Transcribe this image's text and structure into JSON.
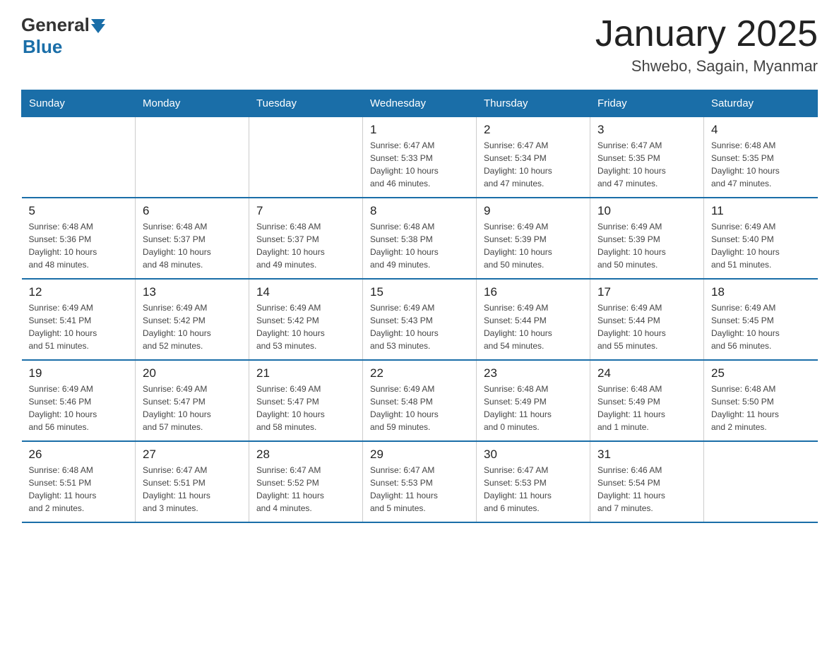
{
  "header": {
    "logo_general": "General",
    "logo_blue": "Blue",
    "month_year": "January 2025",
    "location": "Shwebo, Sagain, Myanmar"
  },
  "weekdays": [
    "Sunday",
    "Monday",
    "Tuesday",
    "Wednesday",
    "Thursday",
    "Friday",
    "Saturday"
  ],
  "weeks": [
    [
      {
        "day": "",
        "info": ""
      },
      {
        "day": "",
        "info": ""
      },
      {
        "day": "",
        "info": ""
      },
      {
        "day": "1",
        "info": "Sunrise: 6:47 AM\nSunset: 5:33 PM\nDaylight: 10 hours\nand 46 minutes."
      },
      {
        "day": "2",
        "info": "Sunrise: 6:47 AM\nSunset: 5:34 PM\nDaylight: 10 hours\nand 47 minutes."
      },
      {
        "day": "3",
        "info": "Sunrise: 6:47 AM\nSunset: 5:35 PM\nDaylight: 10 hours\nand 47 minutes."
      },
      {
        "day": "4",
        "info": "Sunrise: 6:48 AM\nSunset: 5:35 PM\nDaylight: 10 hours\nand 47 minutes."
      }
    ],
    [
      {
        "day": "5",
        "info": "Sunrise: 6:48 AM\nSunset: 5:36 PM\nDaylight: 10 hours\nand 48 minutes."
      },
      {
        "day": "6",
        "info": "Sunrise: 6:48 AM\nSunset: 5:37 PM\nDaylight: 10 hours\nand 48 minutes."
      },
      {
        "day": "7",
        "info": "Sunrise: 6:48 AM\nSunset: 5:37 PM\nDaylight: 10 hours\nand 49 minutes."
      },
      {
        "day": "8",
        "info": "Sunrise: 6:48 AM\nSunset: 5:38 PM\nDaylight: 10 hours\nand 49 minutes."
      },
      {
        "day": "9",
        "info": "Sunrise: 6:49 AM\nSunset: 5:39 PM\nDaylight: 10 hours\nand 50 minutes."
      },
      {
        "day": "10",
        "info": "Sunrise: 6:49 AM\nSunset: 5:39 PM\nDaylight: 10 hours\nand 50 minutes."
      },
      {
        "day": "11",
        "info": "Sunrise: 6:49 AM\nSunset: 5:40 PM\nDaylight: 10 hours\nand 51 minutes."
      }
    ],
    [
      {
        "day": "12",
        "info": "Sunrise: 6:49 AM\nSunset: 5:41 PM\nDaylight: 10 hours\nand 51 minutes."
      },
      {
        "day": "13",
        "info": "Sunrise: 6:49 AM\nSunset: 5:42 PM\nDaylight: 10 hours\nand 52 minutes."
      },
      {
        "day": "14",
        "info": "Sunrise: 6:49 AM\nSunset: 5:42 PM\nDaylight: 10 hours\nand 53 minutes."
      },
      {
        "day": "15",
        "info": "Sunrise: 6:49 AM\nSunset: 5:43 PM\nDaylight: 10 hours\nand 53 minutes."
      },
      {
        "day": "16",
        "info": "Sunrise: 6:49 AM\nSunset: 5:44 PM\nDaylight: 10 hours\nand 54 minutes."
      },
      {
        "day": "17",
        "info": "Sunrise: 6:49 AM\nSunset: 5:44 PM\nDaylight: 10 hours\nand 55 minutes."
      },
      {
        "day": "18",
        "info": "Sunrise: 6:49 AM\nSunset: 5:45 PM\nDaylight: 10 hours\nand 56 minutes."
      }
    ],
    [
      {
        "day": "19",
        "info": "Sunrise: 6:49 AM\nSunset: 5:46 PM\nDaylight: 10 hours\nand 56 minutes."
      },
      {
        "day": "20",
        "info": "Sunrise: 6:49 AM\nSunset: 5:47 PM\nDaylight: 10 hours\nand 57 minutes."
      },
      {
        "day": "21",
        "info": "Sunrise: 6:49 AM\nSunset: 5:47 PM\nDaylight: 10 hours\nand 58 minutes."
      },
      {
        "day": "22",
        "info": "Sunrise: 6:49 AM\nSunset: 5:48 PM\nDaylight: 10 hours\nand 59 minutes."
      },
      {
        "day": "23",
        "info": "Sunrise: 6:48 AM\nSunset: 5:49 PM\nDaylight: 11 hours\nand 0 minutes."
      },
      {
        "day": "24",
        "info": "Sunrise: 6:48 AM\nSunset: 5:49 PM\nDaylight: 11 hours\nand 1 minute."
      },
      {
        "day": "25",
        "info": "Sunrise: 6:48 AM\nSunset: 5:50 PM\nDaylight: 11 hours\nand 2 minutes."
      }
    ],
    [
      {
        "day": "26",
        "info": "Sunrise: 6:48 AM\nSunset: 5:51 PM\nDaylight: 11 hours\nand 2 minutes."
      },
      {
        "day": "27",
        "info": "Sunrise: 6:47 AM\nSunset: 5:51 PM\nDaylight: 11 hours\nand 3 minutes."
      },
      {
        "day": "28",
        "info": "Sunrise: 6:47 AM\nSunset: 5:52 PM\nDaylight: 11 hours\nand 4 minutes."
      },
      {
        "day": "29",
        "info": "Sunrise: 6:47 AM\nSunset: 5:53 PM\nDaylight: 11 hours\nand 5 minutes."
      },
      {
        "day": "30",
        "info": "Sunrise: 6:47 AM\nSunset: 5:53 PM\nDaylight: 11 hours\nand 6 minutes."
      },
      {
        "day": "31",
        "info": "Sunrise: 6:46 AM\nSunset: 5:54 PM\nDaylight: 11 hours\nand 7 minutes."
      },
      {
        "day": "",
        "info": ""
      }
    ]
  ]
}
